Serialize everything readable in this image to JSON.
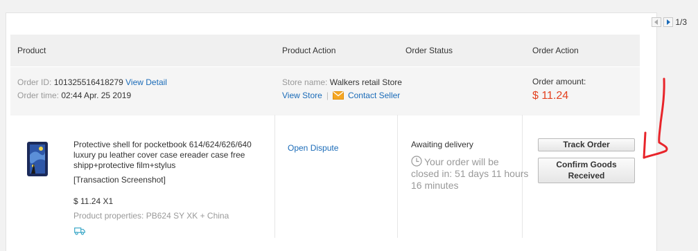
{
  "pager": {
    "text": "1/3"
  },
  "table_headers": {
    "product": "Product",
    "product_action": "Product Action",
    "order_status": "Order Status",
    "order_action": "Order Action"
  },
  "order": {
    "id_label": "Order ID:",
    "id_value": "101325516418279",
    "view_detail": "View Detail",
    "time_label": "Order time:",
    "time_value": "02:44 Apr. 25 2019",
    "store_label": "Store name:",
    "store_value": "Walkers retail Store",
    "view_store": "View Store",
    "separator": "|",
    "contact_seller": "Contact Seller",
    "amount_label": "Order amount:",
    "amount_value": "$ 11.24"
  },
  "product": {
    "title": "Protective shell for pocketbook 614/624/626/640 luxury pu leather cover case ereader case free shipp+protective film+stylus",
    "screenshot_link": "[Transaction Screenshot]",
    "price_qty": "$ 11.24 X1",
    "properties_label": "Product properties:",
    "properties_value": "PB624 SY XK + China",
    "shipping_icon": "truck-icon"
  },
  "product_action": {
    "open_dispute": "Open Dispute"
  },
  "status": {
    "main": "Awaiting delivery",
    "note": "Your order will be closed in: 51 days 11 hours 16 minutes",
    "icon": "clock-icon"
  },
  "actions": {
    "track_order": "Track Order",
    "confirm_goods": "Confirm Goods Received"
  },
  "colors": {
    "link": "#1a6bb8",
    "amount": "#e3411f",
    "annotation": "#e8252b"
  }
}
